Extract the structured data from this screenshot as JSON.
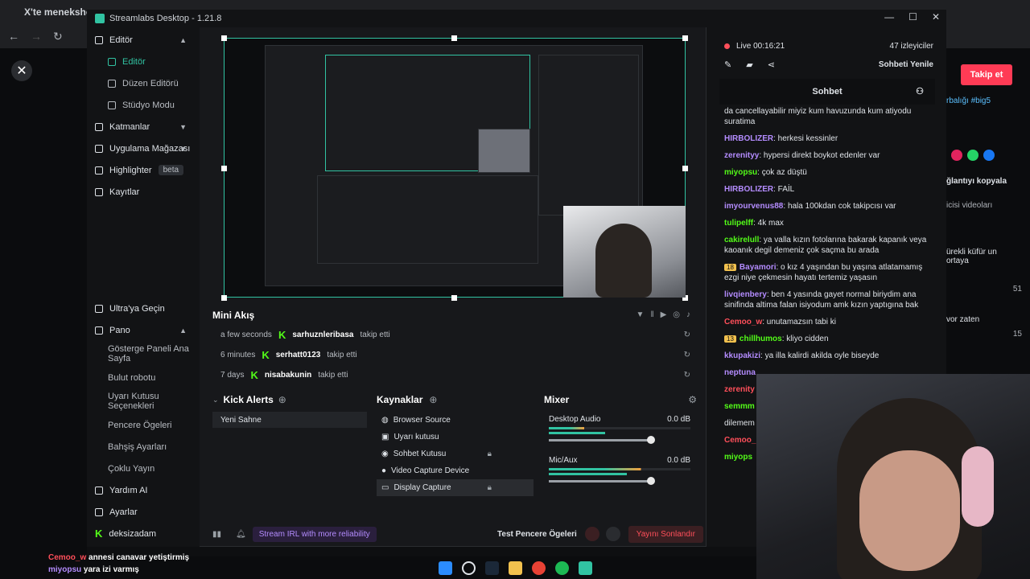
{
  "browser": {
    "tab_label": "X'te menekshe",
    "faint_tabs": [
      "",
      "",
      "",
      ""
    ]
  },
  "app": {
    "title": "Streamlabs Desktop - 1.21.8",
    "brand_color": "#31c3a2"
  },
  "sidebar": {
    "items": [
      {
        "label": "Editör",
        "icon": "editor-icon",
        "caret": "▲"
      },
      {
        "label": "Editör",
        "icon": "editor-sub-icon",
        "active": true
      },
      {
        "label": "Düzen Editörü",
        "icon": "layout-icon"
      },
      {
        "label": "Stüdyo Modu",
        "icon": "studio-icon"
      },
      {
        "label": "Katmanlar",
        "icon": "layers-icon",
        "caret": "▼"
      },
      {
        "label": "Uygulama Mağazası",
        "icon": "store-icon",
        "caret": "▼"
      },
      {
        "label": "Highlighter",
        "icon": "highlighter-icon",
        "badge": "beta"
      },
      {
        "label": "Kayıtlar",
        "icon": "recordings-icon"
      }
    ],
    "bottom_items": [
      {
        "label": "Ultra'ya Geçin",
        "icon": "ultra-icon"
      },
      {
        "label": "Pano",
        "icon": "dashboard-icon",
        "caret": "▲"
      },
      {
        "label": "Gösterge Paneli Ana Sayfa"
      },
      {
        "label": "Bulut robotu"
      },
      {
        "label": "Uyarı Kutusu Seçenekleri"
      },
      {
        "label": "Pencere Ögeleri"
      },
      {
        "label": "Bahşiş Ayarları"
      },
      {
        "label": "Çoklu Yayın"
      },
      {
        "label": "Yardım AI",
        "icon": "help-icon"
      },
      {
        "label": "Ayarlar",
        "icon": "settings-icon"
      },
      {
        "label": "deksizadam",
        "icon": "kick-account-icon"
      }
    ]
  },
  "mini_akis": {
    "title": "Mini Akış",
    "rows": [
      {
        "time": "a few seconds",
        "user": "sarhuznleribasa",
        "action": "takip etti"
      },
      {
        "time": "6 minutes",
        "user": "serhatt0123",
        "action": "takip etti"
      },
      {
        "time": "7 days",
        "user": "nisabakunin",
        "action": "takip etti"
      }
    ]
  },
  "kick_alerts": {
    "title": "Kick Alerts",
    "scene": "Yeni Sahne"
  },
  "sources": {
    "title": "Kaynaklar",
    "items": [
      {
        "label": "Browser Source",
        "icon": "globe-icon"
      },
      {
        "label": "Uyarı kutusu",
        "icon": "alert-box-icon"
      },
      {
        "label": "Sohbet Kutusu",
        "icon": "chat-box-icon",
        "locked": true
      },
      {
        "label": "Video Capture Device",
        "icon": "camera-icon"
      },
      {
        "label": "Display Capture",
        "icon": "monitor-icon",
        "locked": true,
        "selected": true
      }
    ]
  },
  "mixer": {
    "title": "Mixer",
    "channels": [
      {
        "name": "Desktop Audio",
        "db": "0.0 dB",
        "level": 0.25
      },
      {
        "name": "Mic/Aux",
        "db": "0.0 dB",
        "level": 0.65
      }
    ]
  },
  "footer": {
    "stream_irl": "Stream IRL with more reliability",
    "test_label": "Test Pencere Ögeleri",
    "end_label": "Yayını Sonlandır"
  },
  "chat": {
    "live": "Live 00:16:21",
    "viewers": "47 izleyiciler",
    "refresh": "Sohbeti Yenile",
    "title": "Sohbet",
    "messages": [
      {
        "user": "",
        "text": "da cancellayabilir miyiz kum havuzunda kum atiyodu suratima",
        "color": "#dfe3e8"
      },
      {
        "user": "HIRBOLIZER",
        "text": "herkesi kessinler",
        "color": "#b48cff"
      },
      {
        "user": "zerenityy",
        "text": "hypersi direkt boykot edenler var",
        "color": "#b48cff"
      },
      {
        "user": "miyopsu",
        "text": "çok az düştü",
        "color": "#53fc18"
      },
      {
        "user": "HIRBOLIZER",
        "text": "FAİL",
        "color": "#b48cff"
      },
      {
        "user": "imyourvenus88",
        "text": "hala 100kdan cok takipcısı var",
        "color": "#b48cff"
      },
      {
        "user": "tulipelff",
        "text": "4k max",
        "color": "#53fc18"
      },
      {
        "user": "cakirelull",
        "text": "ya valla kızın fotolarına bakarak kapanık veya kaoanık degil demeniz çok saçma bu arada",
        "color": "#53fc18"
      },
      {
        "user": "Bayamori",
        "text": "o kız 4 yaşından bu yaşına atlatamamış ezgi niye çekmesin hayatı tertemiz yaşasın",
        "color": "#b48cff",
        "badge": "18"
      },
      {
        "user": "livqienbery",
        "text": "ben 4 yasında gayet normal biriydim ana sinifinda altima falan isiyodum amk kızın yaptıgına bak",
        "color": "#b48cff"
      },
      {
        "user": "Cemoo_w",
        "text": "unutamazsın tabi ki",
        "color": "#ff4f5a"
      },
      {
        "user": "chillhumos",
        "text": "kliyo cidden",
        "color": "#53fc18",
        "badge": "13"
      },
      {
        "user": "kkupakizi",
        "text": "ya illa kalirdi akilda oyle biseyde",
        "color": "#b48cff"
      },
      {
        "user": "neptuna",
        "text": "",
        "color": "#b48cff"
      },
      {
        "user": "zerenity",
        "text": "",
        "color": "#ff4f5a"
      },
      {
        "user": "semmm",
        "text": "",
        "color": "#53fc18"
      },
      {
        "user": "",
        "text": "dilemem",
        "color": "#dfe3e8"
      },
      {
        "user": "Cemoo_",
        "text": "",
        "color": "#ff4f5a"
      },
      {
        "user": "miyops",
        "text": "",
        "color": "#53fc18"
      }
    ]
  },
  "right_page": {
    "follow": "Takip et",
    "tag": "rbalığı #big5",
    "copy": "ğlantıyı kopyala",
    "videos": "icisi videoları",
    "t1": "ürekli küfür un ortaya",
    "t2": "vor zaten",
    "l1": "51",
    "l2": "15"
  },
  "overlay_chat": [
    {
      "user": "Cemoo_w",
      "text": "annesi canavar yetiştirmiş"
    },
    {
      "user": "miyopsu",
      "text": "yara izi varmış"
    }
  ]
}
